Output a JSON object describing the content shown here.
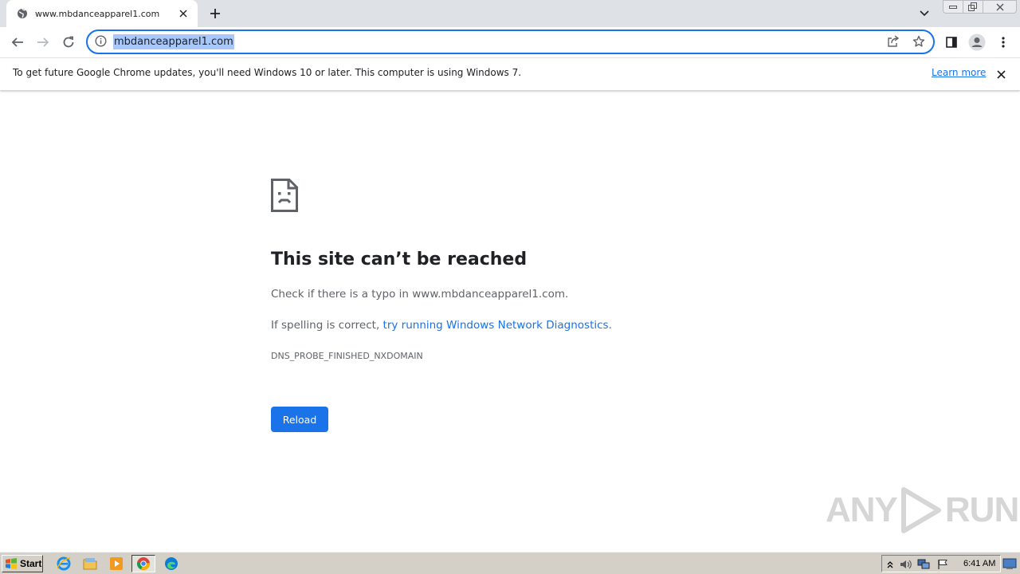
{
  "browser": {
    "tab": {
      "title": "www.mbdanceapparel1.com",
      "favicon": "globe-icon"
    },
    "address_bar": {
      "url": "mbdanceapparel1.com"
    },
    "infobar": {
      "message": "To get future Google Chrome updates, you'll need Windows 10 or later. This computer is using Windows 7.",
      "link": "Learn more"
    }
  },
  "error_page": {
    "title": "This site can’t be reached",
    "line1": "Check if there is a typo in www.mbdanceapparel1.com.",
    "line2_prefix": "If spelling is correct, ",
    "line2_link": "try running Windows Network Diagnostics",
    "line2_suffix": ".",
    "error_code": "DNS_PROBE_FINISHED_NXDOMAIN",
    "reload_label": "Reload"
  },
  "watermark": {
    "left": "ANY",
    "right": "RUN"
  },
  "taskbar": {
    "start_label": "Start",
    "clock": "6:41 AM",
    "pinned": [
      "internet-explorer-icon",
      "folder-icon",
      "media-player-icon",
      "chrome-icon",
      "edge-icon"
    ]
  },
  "colors": {
    "accent": "#1a73e8",
    "tabstrip": "#dee1e6",
    "taskbar": "#d4d0c8"
  }
}
